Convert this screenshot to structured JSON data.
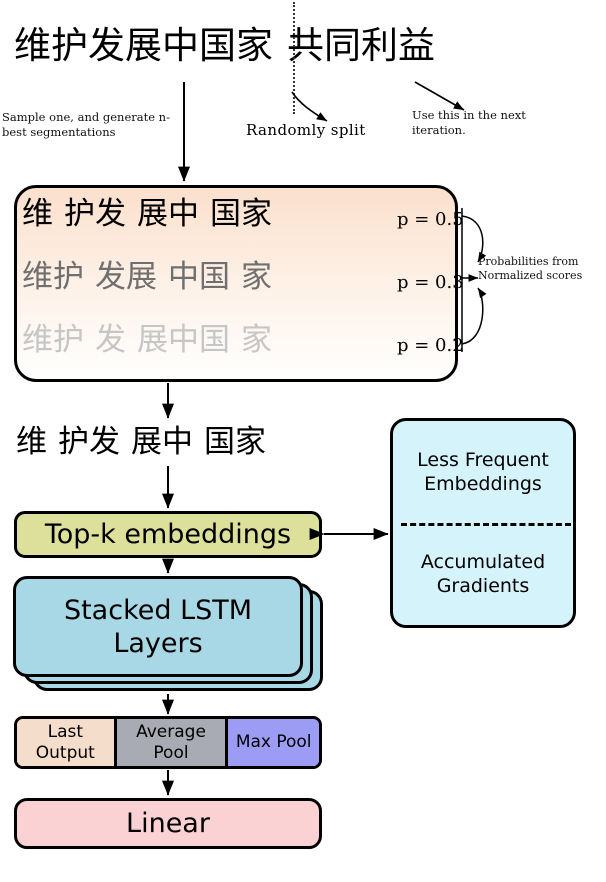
{
  "top": {
    "sentence_part1": "维护发展中国家",
    "sentence_part2": "共同利益"
  },
  "annotations": {
    "sample": "Sample one, and generate n-best segmentations",
    "randomly_split": "Randomly  split",
    "use_next": "Use this in the next iteration.",
    "probabilities": "Probabilities from Normalized scores"
  },
  "nbest": {
    "rows": [
      {
        "a": "维",
        "b": "护发",
        "c": "展中",
        "d": "国家",
        "p": "p = 0.5",
        "shade": "black"
      },
      {
        "a": "维护",
        "b": "发展",
        "c": "中国",
        "d": "家",
        "p": "p = 0.3",
        "shade": "gray"
      },
      {
        "a": "维护",
        "b": "发",
        "c": "展中国",
        "d": "家",
        "p": "p = 0.2",
        "shade": "light-gray"
      }
    ]
  },
  "chosen": {
    "a": "维",
    "b": "护发",
    "c": "展中",
    "d": "国家"
  },
  "nodes": {
    "topk": "Top-k embeddings",
    "lstm_line1": "Stacked LSTM",
    "lstm_line2": "Layers",
    "side_top": "Less Frequent Embeddings",
    "side_bottom": "Accumulated Gradients",
    "pool_last": "Last Output",
    "pool_avg": "Average Pool",
    "pool_max": "Max Pool",
    "linear": "Linear"
  },
  "colors": {
    "nbest_fill_top": "#fbe0cd",
    "topk_fill": "#dce09a",
    "lstm_fill": "#a8d8e6",
    "side_fill": "#d5f3fb",
    "pool_last_fill": "#f4ddcb",
    "pool_avg_fill": "#a8aab4",
    "pool_max_fill": "#9c9cf5",
    "linear_fill": "#fbd2d4",
    "stroke": "#000000"
  }
}
